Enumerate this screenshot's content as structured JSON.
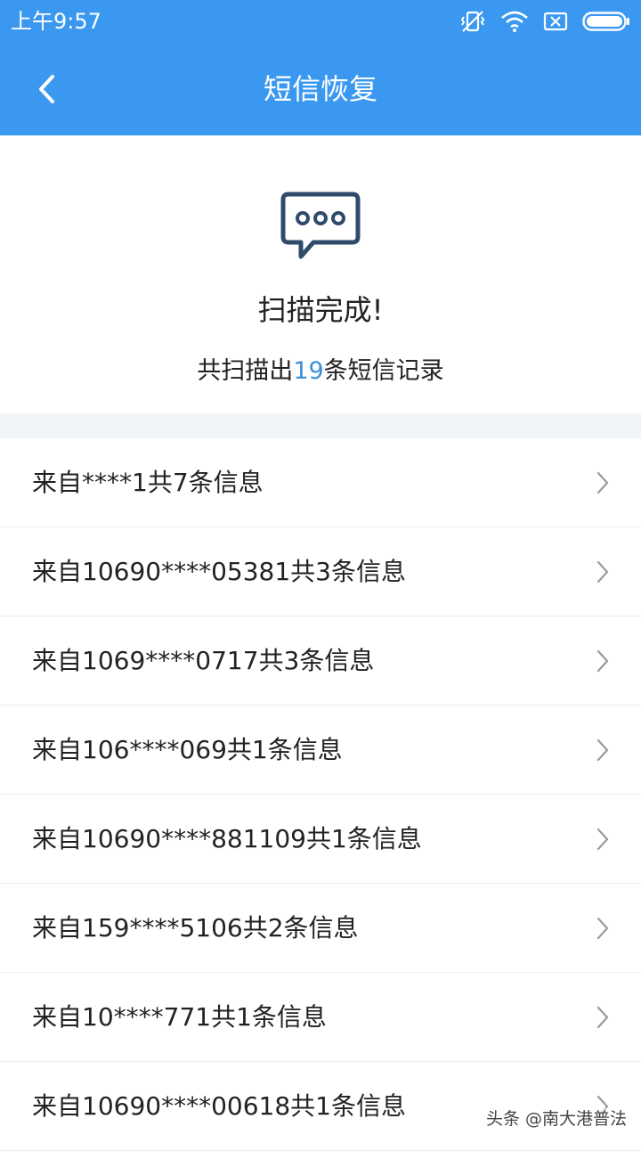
{
  "status_bar": {
    "time": "上午9:57",
    "icons": [
      "vibrate-icon",
      "wifi-icon",
      "sim-disabled-icon",
      "battery-icon"
    ]
  },
  "header": {
    "back_icon": "chevron-left-icon",
    "title": "短信恢复"
  },
  "summary": {
    "icon": "message-bubble-icon",
    "title": "扫描完成!",
    "sub_prefix": "共扫描出",
    "sub_count": "19",
    "sub_suffix": "条短信记录"
  },
  "list": {
    "items": [
      {
        "label": "来自****1共7条信息"
      },
      {
        "label": "来自10690****05381共3条信息"
      },
      {
        "label": "来自1069****0717共3条信息"
      },
      {
        "label": "来自106****069共1条信息"
      },
      {
        "label": "来自10690****881109共1条信息"
      },
      {
        "label": "来自159****5106共2条信息"
      },
      {
        "label": "来自10****771共1条信息"
      },
      {
        "label": "来自10690****00618共1条信息"
      }
    ]
  },
  "watermark": {
    "text": "头条 @南大港普法"
  },
  "colors": {
    "primary": "#3a98f0",
    "accent_count": "#3a8fd8",
    "icon_dark": "#2f4a6b"
  }
}
